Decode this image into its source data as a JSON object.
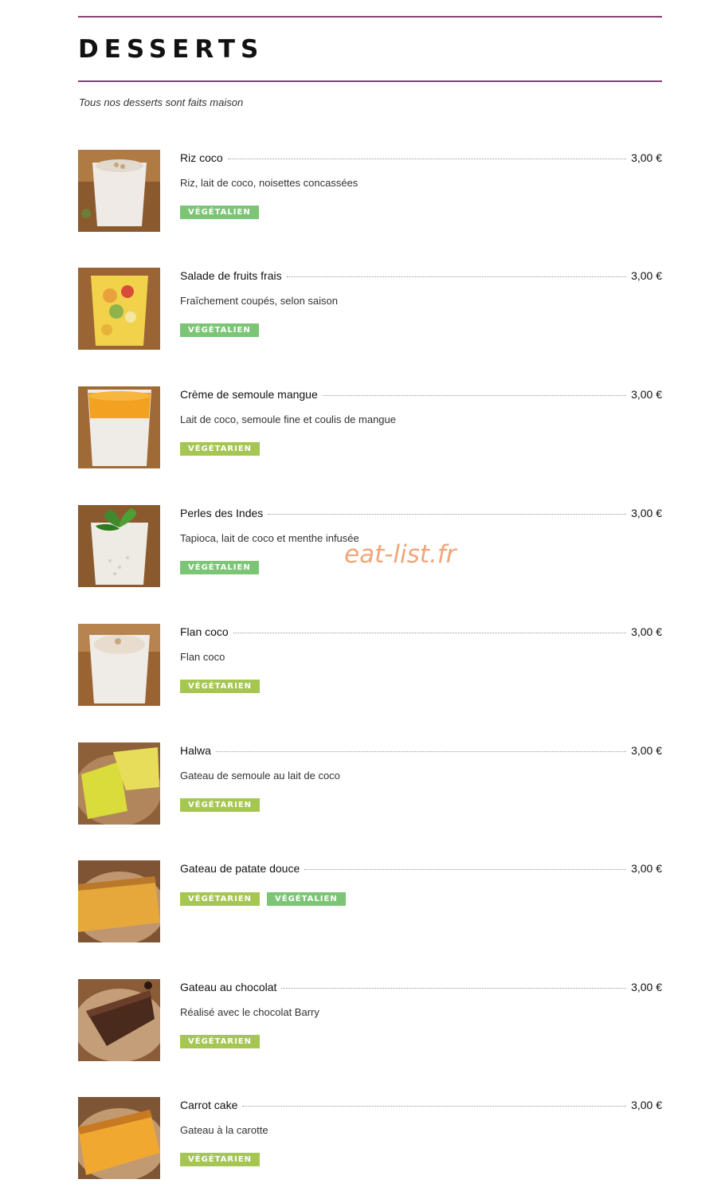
{
  "header": {
    "title": "DESSERTS",
    "subtitle": "Tous nos desserts sont faits maison"
  },
  "watermark": "eat-list.fr",
  "colors": {
    "rule": "#8a3f72",
    "vegan_tag": "#7cc576",
    "veggie_tag": "#a6c653",
    "watermark": "#f0a679"
  },
  "items": [
    {
      "name": "Riz coco",
      "price": "3,00 €",
      "desc": "Riz, lait de coco, noisettes concassées",
      "tags": [
        "VÉGÉTALIEN"
      ]
    },
    {
      "name": "Salade de fruits frais",
      "price": "3,00 €",
      "desc": "Fraîchement coupés, selon saison",
      "tags": [
        "VÉGÉTALIEN"
      ]
    },
    {
      "name": "Crème de semoule mangue",
      "price": "3,00 €",
      "desc": "Lait de coco, semoule fine et coulis de mangue",
      "tags": [
        "VÉGÉTARIEN"
      ]
    },
    {
      "name": "Perles des Indes",
      "price": "3,00 €",
      "desc": "Tapioca, lait de coco et menthe infusée",
      "tags": [
        "VÉGÉTALIEN"
      ]
    },
    {
      "name": "Flan coco",
      "price": "3,00 €",
      "desc": "Flan coco",
      "tags": [
        "VÉGÉTARIEN"
      ]
    },
    {
      "name": "Halwa",
      "price": "3,00 €",
      "desc": "Gateau de semoule au lait de coco",
      "tags": [
        "VÉGÉTARIEN"
      ]
    },
    {
      "name": "Gateau de patate douce",
      "price": "3,00 €",
      "desc": "",
      "tags": [
        "VÉGÉTARIEN",
        "VÉGÉTALIEN"
      ]
    },
    {
      "name": "Gateau au chocolat",
      "price": "3,00 €",
      "desc": "Réalisé avec le chocolat Barry",
      "tags": [
        "VÉGÉTARIEN"
      ]
    },
    {
      "name": "Carrot cake",
      "price": "3,00 €",
      "desc": "Gateau à la carotte",
      "tags": [
        "VÉGÉTARIEN"
      ]
    }
  ]
}
